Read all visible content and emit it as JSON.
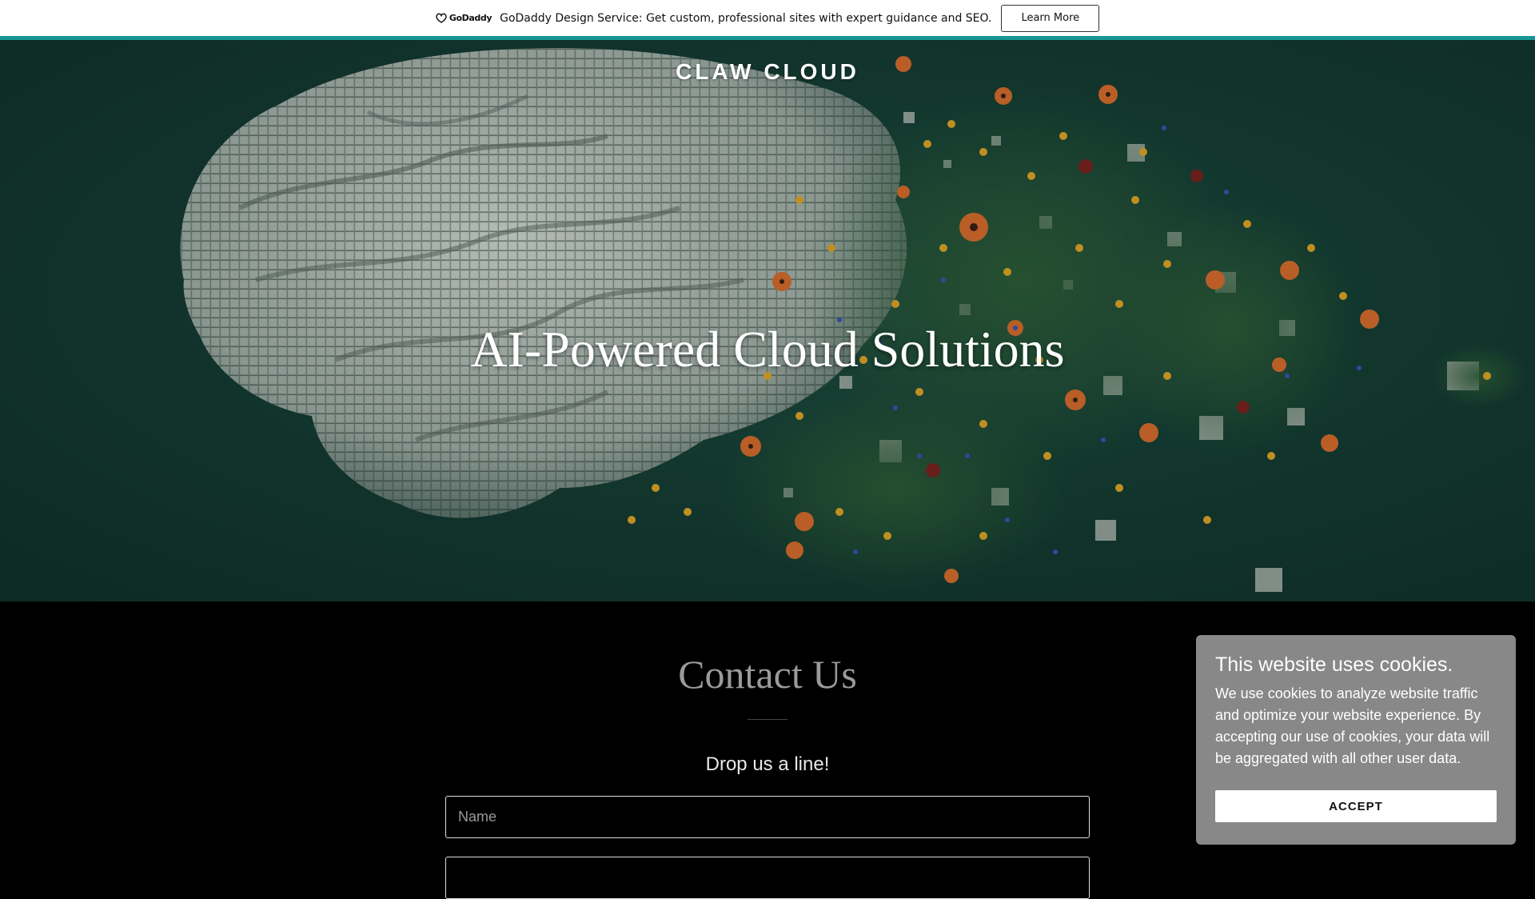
{
  "promo": {
    "logo_text": "GoDaddy",
    "message": "GoDaddy Design Service: Get custom, professional sites with expert guidance and SEO.",
    "button_label": "Learn More"
  },
  "header": {
    "site_title": "CLAW CLOUD"
  },
  "hero": {
    "heading": "AI-Powered Cloud Solutions"
  },
  "contact": {
    "title": "Contact Us",
    "tagline": "Drop us a line!",
    "name_placeholder": "Name"
  },
  "cookie_banner": {
    "title": "This website uses cookies.",
    "body": "We use cookies to analyze website traffic and optimize your website experience. By accepting our use of cookies, your data will be aggregated with all other user data.",
    "accept_label": "ACCEPT"
  },
  "colors": {
    "accent": "#1a9595",
    "hero_bg": "#143a31",
    "cookie_bg": "#888888",
    "page_bg": "#000000"
  }
}
